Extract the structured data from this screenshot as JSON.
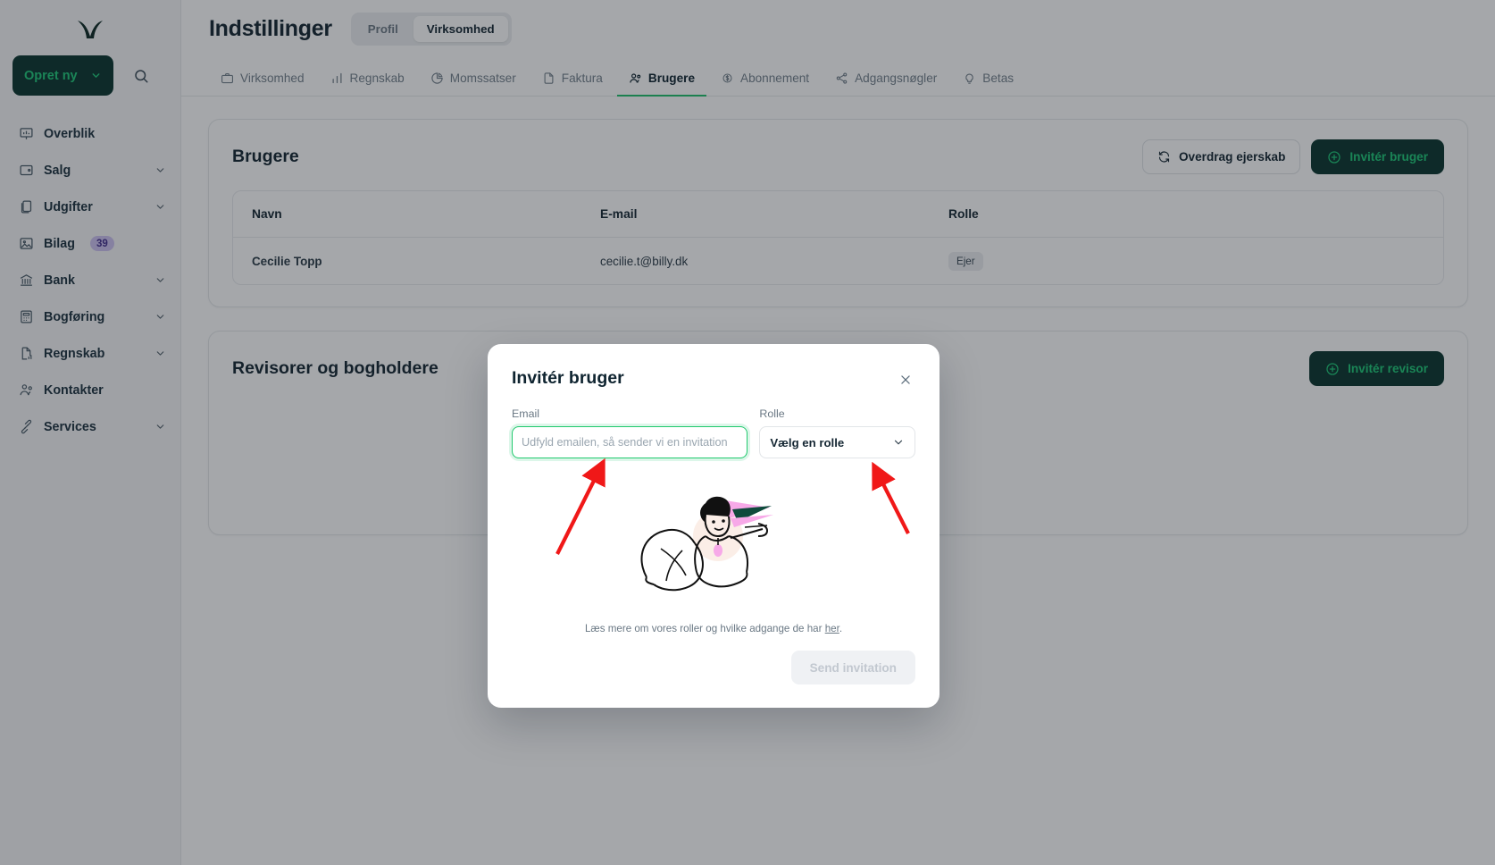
{
  "sidebar": {
    "logo_name": "billy-logo",
    "create_button": {
      "label": "Opret ny",
      "icon": "chevron-down-icon"
    },
    "search_icon": "search-icon",
    "items": [
      {
        "label": "Overblik",
        "icon": "dashboard-icon",
        "chevron": false,
        "badge": null
      },
      {
        "label": "Salg",
        "icon": "sales-icon",
        "chevron": true,
        "badge": null
      },
      {
        "label": "Udgifter",
        "icon": "expenses-icon",
        "chevron": true,
        "badge": null
      },
      {
        "label": "Bilag",
        "icon": "receipts-icon",
        "chevron": false,
        "badge": "39"
      },
      {
        "label": "Bank",
        "icon": "bank-icon",
        "chevron": true,
        "badge": null
      },
      {
        "label": "Bogføring",
        "icon": "bookkeeping-icon",
        "chevron": true,
        "badge": null
      },
      {
        "label": "Regnskab",
        "icon": "accounting-icon",
        "chevron": true,
        "badge": null
      },
      {
        "label": "Kontakter",
        "icon": "contacts-icon",
        "chevron": false,
        "badge": null
      },
      {
        "label": "Services",
        "icon": "services-icon",
        "chevron": true,
        "badge": null
      }
    ]
  },
  "header": {
    "title": "Indstillinger",
    "segments": [
      {
        "label": "Profil",
        "active": false
      },
      {
        "label": "Virksomhed",
        "active": true
      }
    ]
  },
  "tabs": [
    {
      "label": "Virksomhed",
      "icon": "briefcase-icon",
      "active": false
    },
    {
      "label": "Regnskab",
      "icon": "bar-chart-icon",
      "active": false
    },
    {
      "label": "Momssatser",
      "icon": "pie-chart-icon",
      "active": false
    },
    {
      "label": "Faktura",
      "icon": "document-icon",
      "active": false
    },
    {
      "label": "Brugere",
      "icon": "users-icon",
      "active": true
    },
    {
      "label": "Abonnement",
      "icon": "subscription-icon",
      "active": false
    },
    {
      "label": "Adgangsnøgler",
      "icon": "share-nodes-icon",
      "active": false
    },
    {
      "label": "Betas",
      "icon": "lightbulb-icon",
      "active": false
    }
  ],
  "users_card": {
    "title": "Brugere",
    "transfer_button": {
      "label": "Overdrag ejerskab",
      "icon": "transfer-icon"
    },
    "invite_button": {
      "label": "Invitér bruger",
      "icon": "plus-circle-icon"
    },
    "columns": [
      "Navn",
      "E-mail",
      "Rolle"
    ],
    "rows": [
      {
        "name": "Cecilie Topp",
        "email": "cecilie.t@billy.dk",
        "role": "Ejer"
      }
    ]
  },
  "accountants_card": {
    "title": "Revisorer og bogholdere",
    "invite_button": {
      "label": "Invitér revisor",
      "icon": "plus-circle-icon"
    }
  },
  "modal": {
    "title": "Invitér bruger",
    "close_icon": "close-icon",
    "email": {
      "label": "Email",
      "placeholder": "Udfyld emailen, så sender vi en invitation",
      "value": ""
    },
    "role": {
      "label": "Rolle",
      "selected": "Vælg en rolle",
      "chevron": "chevron-down-icon"
    },
    "illustration": "person-sending-paper-plane-illustration",
    "note_prefix": "Læs mere om vores roller og hvilke adgange de har ",
    "note_link": "her",
    "note_suffix": ".",
    "submit": {
      "label": "Send invitation",
      "disabled": true
    }
  },
  "colors": {
    "brand_dark": "#0c3630",
    "brand_green": "#21c97a",
    "accent_tab": "#22c06c",
    "badge_purple_bg": "#cdc2f0",
    "badge_purple_fg": "#44308f",
    "annotation_red": "#f01818",
    "focus_green": "#21c96e"
  },
  "annotations": [
    {
      "name": "arrow-to-email-field",
      "color": "#f01818"
    },
    {
      "name": "arrow-to-role-select",
      "color": "#f01818"
    }
  ]
}
